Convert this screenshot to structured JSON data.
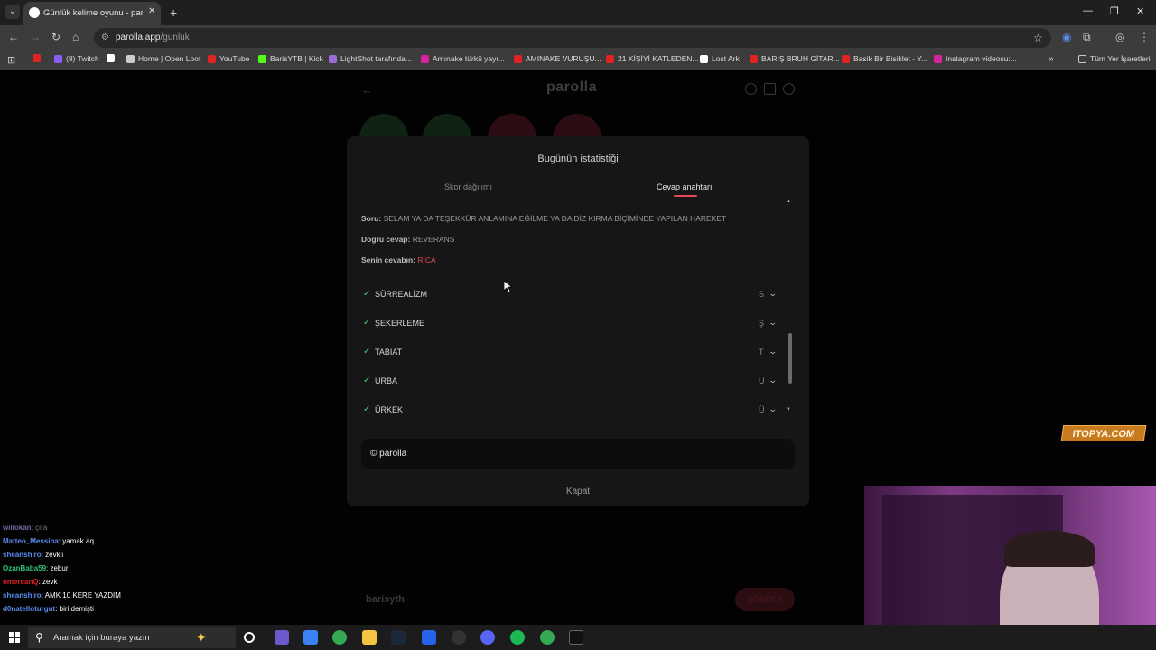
{
  "browser": {
    "tab_title": "Günlük kelime oyunu - parolla",
    "url_host": "parolla.app",
    "url_path": "/gunluk",
    "bookmarks": [
      {
        "label": "",
        "color": "#e02424"
      },
      {
        "label": "(8) Twitch",
        "color": "#8b5cf6"
      },
      {
        "label": "",
        "color": "#ffffff"
      },
      {
        "label": "Home | Open Loot",
        "color": "#cccccc"
      },
      {
        "label": "YouTube",
        "color": "#e02424"
      },
      {
        "label": "BarisYTB | Kick",
        "color": "#53fc18"
      },
      {
        "label": "LightShot tarafında...",
        "color": "#9b6bd8"
      },
      {
        "label": "Amınake türkü yayı...",
        "color": "#d6249f"
      },
      {
        "label": "AMINAKE VURUŞU...",
        "color": "#e02424"
      },
      {
        "label": "21 KİŞİYİ KATLEDEN...",
        "color": "#e02424"
      },
      {
        "label": "Lost Ark",
        "color": "#ffffff"
      },
      {
        "label": "BARIŞ BRUH GİTAR...",
        "color": "#e02424"
      },
      {
        "label": "Basik Bir Bisiklet - Y...",
        "color": "#e02424"
      },
      {
        "label": "Instagram videosu:...",
        "color": "#d6249f"
      }
    ],
    "all_bookmarks_label": "Tüm Yer İşaretleri"
  },
  "page": {
    "logo": "parolla",
    "input_name": "barisyth",
    "send_label": "GÖNDER"
  },
  "modal": {
    "title": "Bugünün istatistiği",
    "tabs": [
      "Skor dağılımı",
      "Cevap anahtarı"
    ],
    "question_label": "Soru:",
    "question": "SELAM YA DA TEŞEKKÜR ANLAMINA EĞİLME YA DA DİZ KIRMA BİÇİMİNDE YAPILAN HAREKET",
    "correct_label": "Doğru cevap:",
    "correct": "REVERANS",
    "your_label": "Senin cevabın:",
    "yours": "RİCA",
    "rows": [
      {
        "word": "SÜRREALİZM",
        "letter": "S"
      },
      {
        "word": "ŞEKERLEME",
        "letter": "Ş"
      },
      {
        "word": "TABİAT",
        "letter": "T"
      },
      {
        "word": "URBA",
        "letter": "U"
      },
      {
        "word": "ÜRKEK",
        "letter": "Ü"
      }
    ],
    "footer": "© parolla",
    "close": "Kapat"
  },
  "chat": [
    {
      "user": "willokan",
      "text": ": çıra",
      "color": "#6a6aa0"
    },
    {
      "user": "Matteo_Messina",
      "text": ": yamak aq",
      "color": "#5b8cf0"
    },
    {
      "user": "sheanshiro",
      "text": ": zevkli",
      "color": "#5b8cf0"
    },
    {
      "user": "OzanBaba59",
      "text": ": zebur",
      "color": "#33c17a"
    },
    {
      "user": "omercanQ",
      "text": ": zevk",
      "color": "#e02424"
    },
    {
      "user": "sheanshiro",
      "text": ": AMK 10 KERE YAZDIM",
      "color": "#5b8cf0"
    },
    {
      "user": "d0natelloturgut",
      "text": ": biri demişti",
      "color": "#5b8cf0"
    }
  ],
  "watermark": "ITOPYA.COM",
  "taskbar": {
    "search_placeholder": "Aramak için buraya yazın"
  }
}
